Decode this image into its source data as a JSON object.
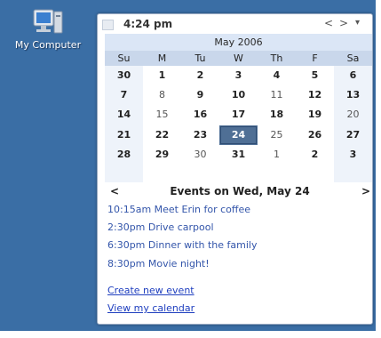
{
  "desktop": {
    "icon_label": "My Computer",
    "icon": "computer-icon"
  },
  "gadget": {
    "time": "4:24 pm",
    "prev_symbol": "<",
    "next_symbol": ">",
    "menu_symbol": "▾",
    "month_title": "May 2006",
    "weekdays": [
      "Su",
      "M",
      "Tu",
      "W",
      "Th",
      "F",
      "Sa"
    ],
    "weeks": [
      [
        "30",
        "1",
        "2",
        "3",
        "4",
        "5",
        "6"
      ],
      [
        "7",
        "8",
        "9",
        "10",
        "11",
        "12",
        "13"
      ],
      [
        "14",
        "15",
        "16",
        "17",
        "18",
        "19",
        "20"
      ],
      [
        "21",
        "22",
        "23",
        "24",
        "25",
        "26",
        "27"
      ],
      [
        "28",
        "29",
        "30",
        "31",
        "1",
        "2",
        "3"
      ]
    ],
    "selected_day": "24",
    "events_prev": "<",
    "events_next": ">",
    "events_title": "Events on Wed, May 24",
    "events": [
      "10:15am Meet Erin for coffee",
      "2:30pm Drive carpool",
      "6:30pm Dinner with the family",
      "8:30pm Movie night!"
    ],
    "create_link": "Create new event",
    "view_link": "View my calendar"
  },
  "colors": {
    "desktop": "#3a6ea5",
    "month_bar": "#dbe6f6",
    "weekday_bar": "#c9d7eb",
    "selected_day": "#4f6f95",
    "event_text": "#3355aa",
    "link": "#1f3fbf"
  }
}
